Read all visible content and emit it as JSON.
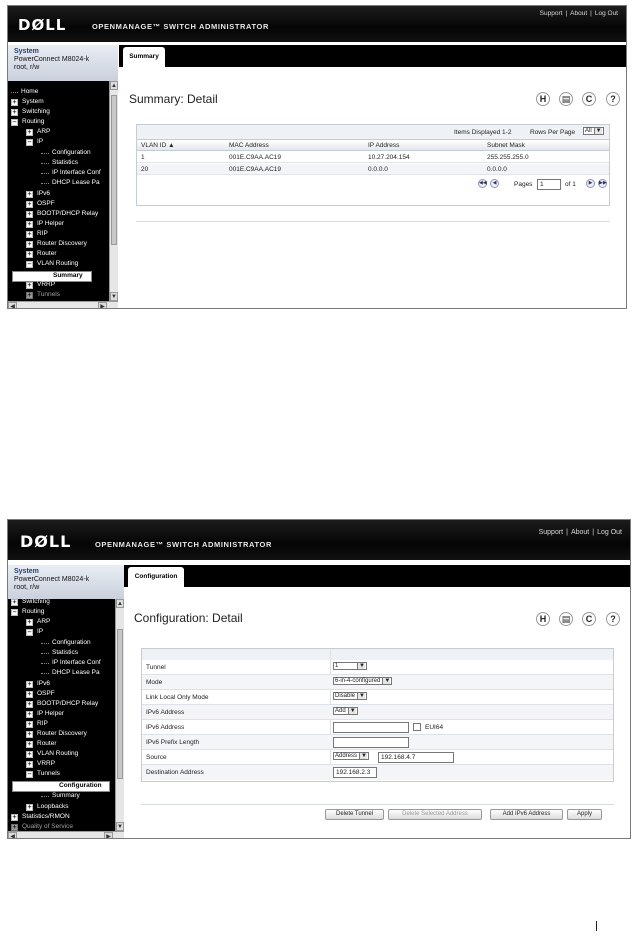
{
  "header": {
    "logo": "DØLL",
    "product": "OPENMANAGE™ SWITCH ADMINISTRATOR",
    "links": [
      "Support",
      "About",
      "Log Out"
    ]
  },
  "system": {
    "name": "System",
    "model": "PowerConnect M8024-k",
    "user": "root, r/w"
  },
  "icons": {
    "save": "H",
    "print": "printer-icon",
    "refresh": "C",
    "help": "?"
  },
  "screen1": {
    "tree": [
      "Home",
      "System",
      "Switching",
      "Routing",
      "ARP",
      "IP",
      "Configuration",
      "Statistics",
      "IP Interface Conf",
      "DHCP Lease Pa",
      "IPv6",
      "OSPF",
      "BOOTP/DHCP Relay",
      "IP Helper",
      "RIP",
      "Router Discovery",
      "Router",
      "VLAN Routing",
      "Summary",
      "VRRP",
      "Tunnels"
    ],
    "tab": "Summary",
    "title": "Summary: Detail",
    "items_displayed": "Items Displayed 1-2",
    "rows_per_page_label": "Rows Per Page",
    "rows_per_page_value": "All",
    "columns": [
      "VLAN ID ▲",
      "MAC Address",
      "IP Address",
      "Subnet Mask"
    ],
    "rows": [
      [
        "1",
        "001E.C9AA.AC19",
        "10.27.204.154",
        "255.255.255.0"
      ],
      [
        "20",
        "001E.C9AA.AC19",
        "0.0.0.0",
        "0.0.0.0"
      ]
    ],
    "pages_label": "Pages",
    "page_value": "1",
    "of_label": "of 1"
  },
  "screen2": {
    "tree": [
      "Switching",
      "Routing",
      "ARP",
      "IP",
      "Configuration",
      "Statistics",
      "IP Interface Conf",
      "DHCP Lease Pa",
      "IPv6",
      "OSPF",
      "BOOTP/DHCP Relay",
      "IP Helper",
      "RIP",
      "Router Discovery",
      "Router",
      "VLAN Routing",
      "VRRP",
      "Tunnels",
      "Configuration",
      "Summary",
      "Loopbacks",
      "Statistics/RMON",
      "Quality of Service"
    ],
    "tab": "Configuration",
    "title": "Configuration: Detail",
    "fields": [
      {
        "label": "Tunnel",
        "value": "1"
      },
      {
        "label": "Mode",
        "value": "6-in-4-configured"
      },
      {
        "label": "Link Local Only Mode",
        "value": "Disable"
      },
      {
        "label": "IPv6 Address",
        "value": "Add"
      },
      {
        "label": "IPv6 Address",
        "value": "",
        "checkbox_label": "EUI64"
      },
      {
        "label": "IPv6 Prefix Length",
        "value": ""
      },
      {
        "label": "Source",
        "value": "Address",
        "extra": "192.168.4.7"
      },
      {
        "label": "Destination Address",
        "value": "192.168.2.3"
      }
    ],
    "buttons": [
      "Delete Tunnel",
      "Delete Selected Address",
      "Add IPv6 Address",
      "Apply"
    ]
  }
}
